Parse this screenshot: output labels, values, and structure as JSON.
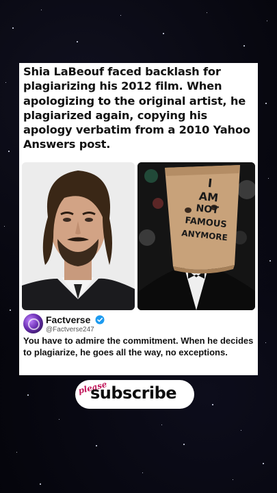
{
  "post": {
    "headline": "Shia LaBeouf faced backlash for plagiarizing his 2012 film. When apologizing to the original artist, he plagiarized again, copying his apology verbatim from a 2010 Yahoo Answers post.",
    "photo_right_sign": [
      "I",
      "AM",
      "NOT",
      "FAMOUS",
      "ANYMORE"
    ],
    "author": {
      "name": "Factverse",
      "handle": "@Factverse247",
      "verified_icon": "verified-badge-icon",
      "verified_color": "#1d9bf0"
    },
    "comment": "You have to admire the commitment. When he decides to plagiarize, he goes all the way, no exceptions."
  },
  "subscribe": {
    "please_label": "please",
    "label": "subscribe"
  },
  "colors": {
    "background": "#04040a",
    "card": "#ffffff",
    "please": "#c2185b"
  }
}
